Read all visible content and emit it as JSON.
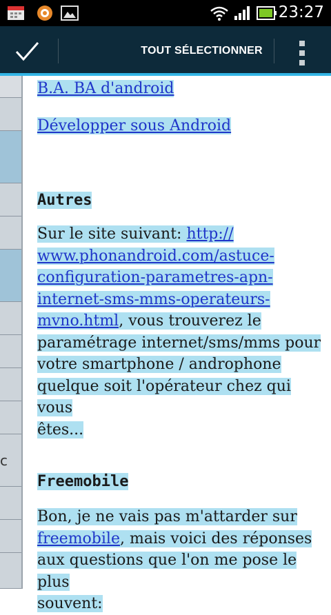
{
  "status_bar": {
    "time": "23:27",
    "icons": [
      "calendar-icon",
      "app-notification-icon",
      "gallery-icon",
      "wifi-icon",
      "signal-icon",
      "battery-icon"
    ]
  },
  "action_bar": {
    "done_icon": "checkmark-icon",
    "select_all_label": "TOUT SÉLECTIONNER",
    "overflow_icon": "overflow-menu-icon"
  },
  "content": {
    "link_ba_ba": "B.A. BA d'android",
    "link_developper": "Développer sous Android",
    "heading_autres": "Autres",
    "autres_text_1": "Sur le site suivant: ",
    "autres_link_1": "http://",
    "autres_link_2": "www.phonandroid.com/astuce-",
    "autres_link_3": "configuration-parametres-apn-",
    "autres_link_4": "internet-sms-mms-operateurs-",
    "autres_link_5": "mvno.html",
    "autres_text_2": ", vous trouverez le",
    "autres_text_3": "paramétrage internet/sms/mms pour",
    "autres_text_4": "votre smartphone / androphone",
    "autres_text_5": "quelque soit l'opérateur chez qui vous",
    "autres_text_6": "êtes...",
    "heading_freemobile": "Freemobile",
    "free_text_1": "Bon, je ne vais pas m'attarder sur",
    "free_link": "freemobile",
    "free_text_2": ", mais voici des réponses",
    "free_text_3": "aux questions que l'on me pose le plus",
    "free_text_4": "souvent:"
  },
  "left_strip": {
    "visible_char": "c"
  },
  "colors": {
    "action_bar": "#0d2a3a",
    "accent": "#33b5e5",
    "selection_highlight": "#aee0f1",
    "link": "#1f35c9"
  }
}
